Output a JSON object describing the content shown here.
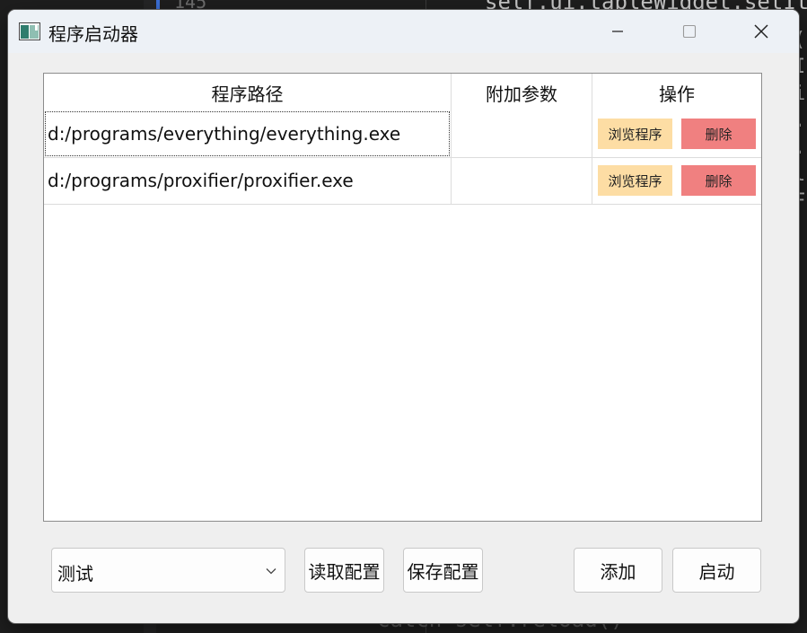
{
  "background_editor": {
    "line_number": "145",
    "code_top": "self.ui.tableWidget.setIt",
    "code_bottom": "catch   self.reload()",
    "right_chars": [
      "(",
      "I",
      "",
      "",
      "",
      "i",
      ".",
      ".",
      "l",
      "",
      "",
      "",
      "",
      "",
      "",
      "F"
    ]
  },
  "window": {
    "title": "程序启动器",
    "controls": {
      "minimize": "minimize",
      "maximize": "maximize",
      "close": "close"
    }
  },
  "table": {
    "headers": [
      "程序路径",
      "附加参数",
      "操作"
    ],
    "rows": [
      {
        "path": "d:/programs/everything/everything.exe",
        "args": "",
        "browse_label": "浏览程序",
        "delete_label": "删除"
      },
      {
        "path": "d:/programs/proxifier/proxifier.exe",
        "args": "",
        "browse_label": "浏览程序",
        "delete_label": "删除"
      }
    ]
  },
  "footer": {
    "config_select": {
      "value": "测试"
    },
    "load_config_label": "读取配置",
    "save_config_label": "保存配置",
    "add_label": "添加",
    "launch_label": "启动"
  },
  "colors": {
    "browse_button": "#fddda4",
    "delete_button": "#f08080",
    "titlebar": "#edf1f6",
    "window_bg": "#efefef"
  }
}
